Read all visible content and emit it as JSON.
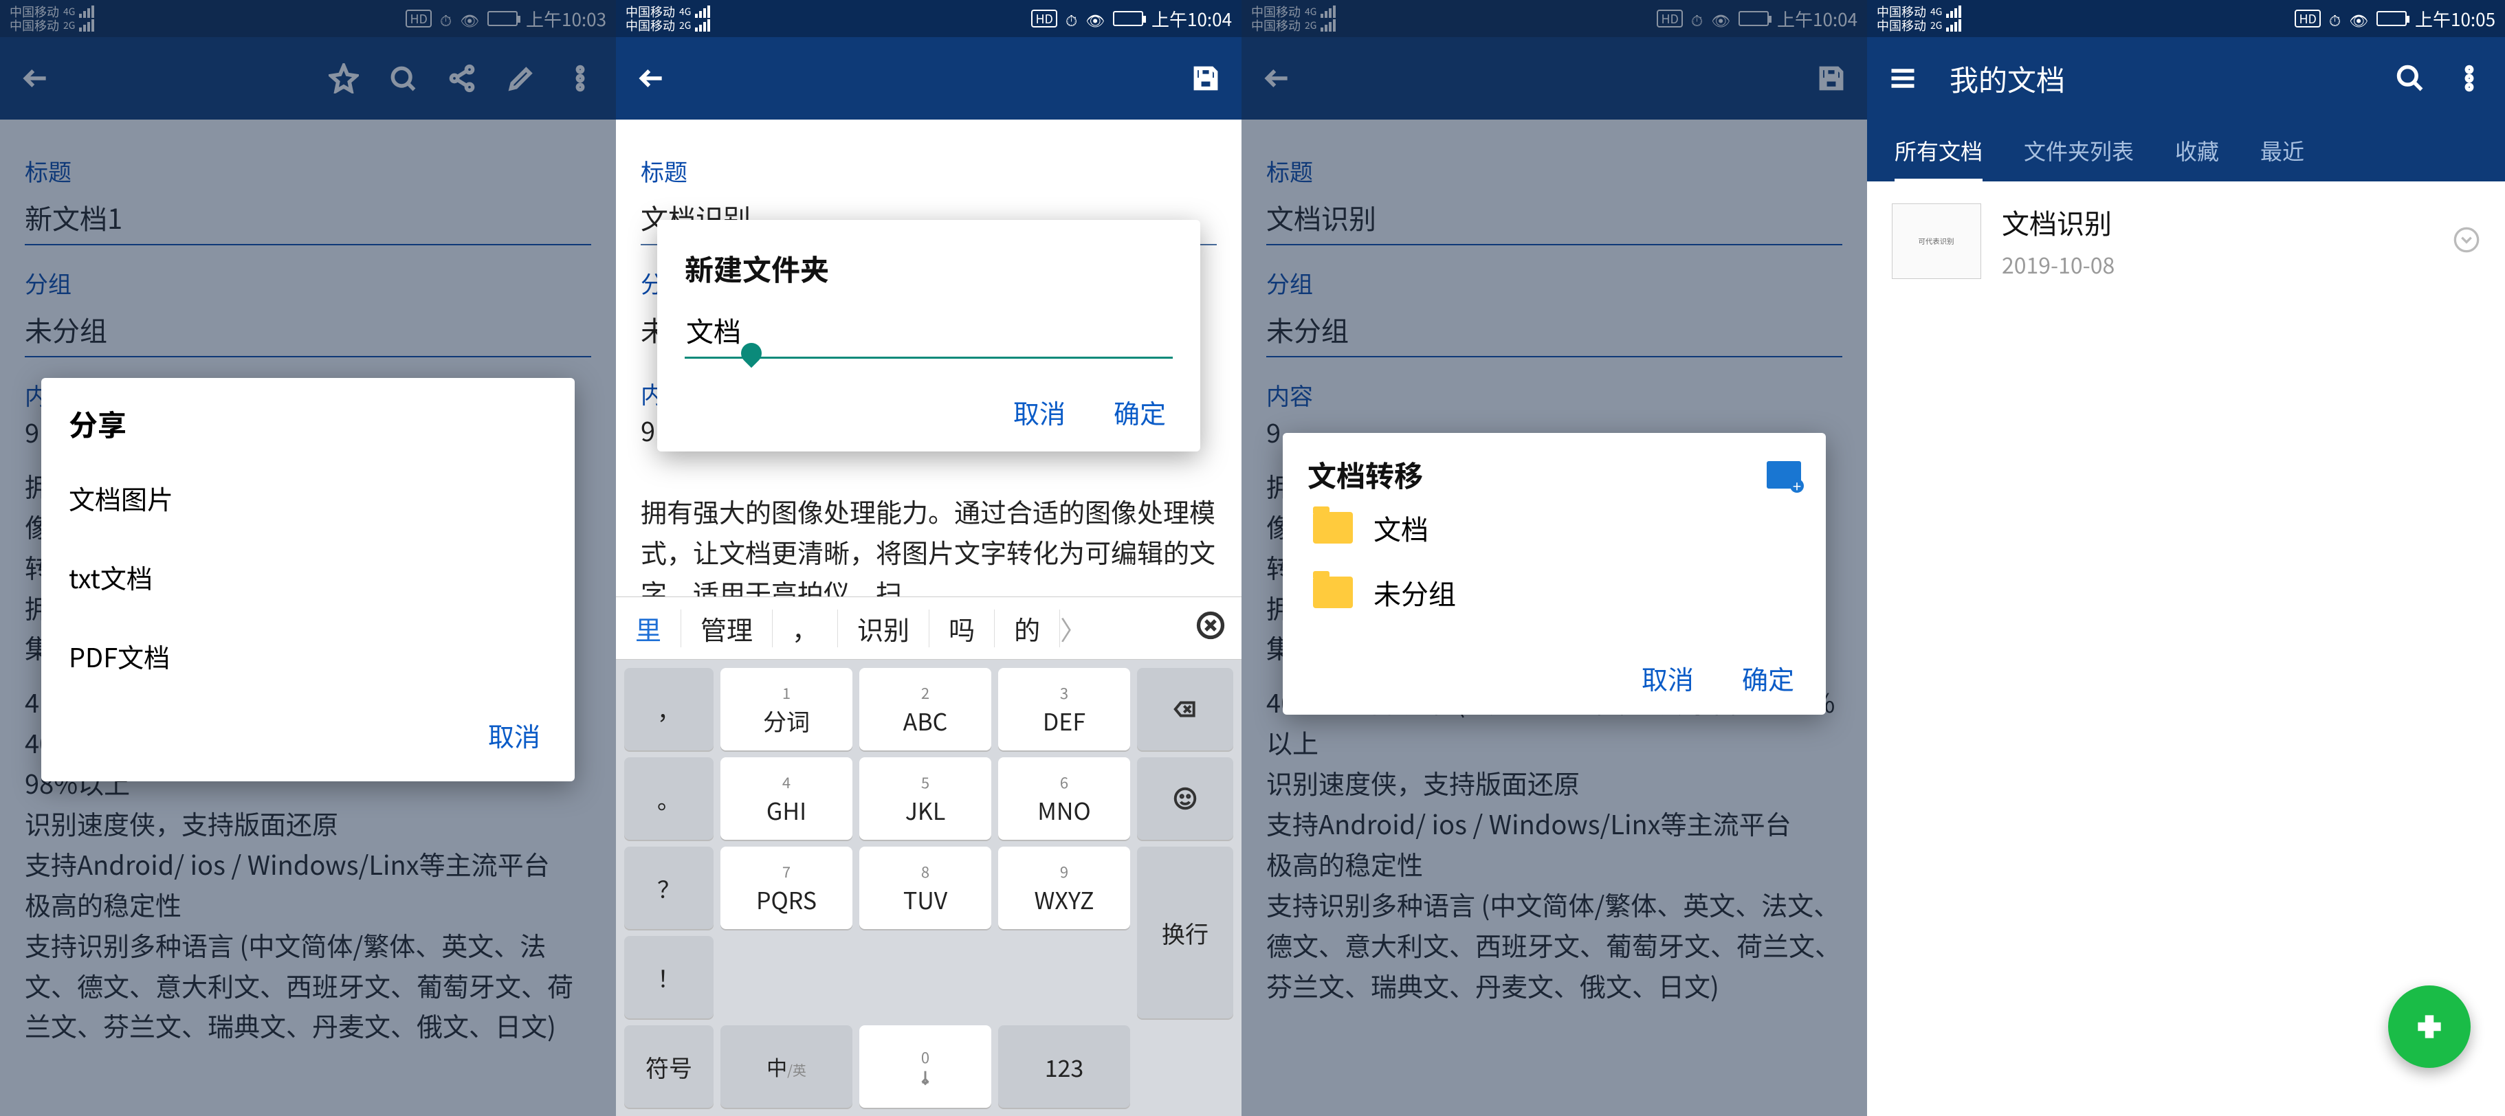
{
  "screens": [
    {
      "status": {
        "carrier": "中国移动",
        "net_tags": [
          "4G",
          "2G"
        ],
        "hd": "HD",
        "time": "上午10:03"
      },
      "form": {
        "title_label": "标题",
        "title_value": "新文档1",
        "group_label": "分组",
        "group_value": "未分组",
        "content_label": "内"
      },
      "body_prefix": "9",
      "body_suffix_lines": "400DPI扫描文档(AI办公纯文档） 识别率高达98%以上\n识别速度侠，支持版面还原\n支持Android/ ios / Windows/Linx等主流平台\n极高的稳定性\n支持识别多种语言 (中文简体/繁体、英文、法文、德文、意大利文、西班牙文、葡萄牙文、荷兰文、芬兰文、瑞典文、丹麦文、俄文、日文)",
      "body_mid_chars": [
        "拥",
        "像",
        "转",
        "拥",
        "集",
        "4"
      ],
      "share": {
        "title": "分享",
        "items": [
          "文档图片",
          "txt文档",
          "PDF文档"
        ],
        "cancel": "取消"
      }
    },
    {
      "status": {
        "carrier": "中国移动",
        "net_tags": [
          "4G",
          "2G"
        ],
        "hd": "HD",
        "time": "上午10:04"
      },
      "form": {
        "title_label": "标题",
        "title_value": "文档识别",
        "group_label": "分",
        "group_value": "未",
        "content_label": "内"
      },
      "body_full": "9.通用文档识别SDK\n\n拥有强大的图像处理能力。通过合适的图像处理模式，让文档更清晰，将图片文字转化为可编辑的文字，适用于高拍仪、扫",
      "dialog": {
        "title": "新建文件夹",
        "input_value": "文档",
        "cancel": "取消",
        "confirm": "确定"
      },
      "keyboard": {
        "suggestions": [
          "里",
          "管理",
          "，",
          "识别",
          "吗",
          "的"
        ],
        "keys_row1": [
          {
            "n": "1",
            "l": "分词"
          },
          {
            "n": "2",
            "l": "ABC"
          },
          {
            "n": "3",
            "l": "DEF"
          }
        ],
        "keys_row2": [
          {
            "n": "4",
            "l": "GHI"
          },
          {
            "n": "5",
            "l": "JKL"
          },
          {
            "n": "6",
            "l": "MNO"
          }
        ],
        "keys_row3": [
          {
            "n": "7",
            "l": "PQRS"
          },
          {
            "n": "8",
            "l": "TUV"
          },
          {
            "n": "9",
            "l": "WXYZ"
          }
        ],
        "left_col": [
          "，",
          "。",
          "？",
          "！"
        ],
        "right_col_enter": "换行",
        "bottom": {
          "symbol": "符号",
          "lang": "中/英",
          "num": "123"
        }
      }
    },
    {
      "status": {
        "carrier": "中国移动",
        "net_tags": [
          "4G",
          "2G"
        ],
        "hd": "HD",
        "time": "上午10:04"
      },
      "form": {
        "title_label": "标题",
        "title_value": "文档识别",
        "group_label": "分组",
        "group_value": "未分组",
        "content_label": "内容"
      },
      "body_prefix": "9",
      "body_mid_chars": [
        "拥",
        "像",
        "转",
        "拥",
        "集"
      ],
      "body_suffix_lines": "400DPI扫描文档(AI办公纯文档） 识别率高达98%以上\n识别速度侠，支持版面还原\n支持Android/ ios / Windows/Linx等主流平台\n极高的稳定性\n支持识别多种语言 (中文简体/繁体、英文、法文、德文、意大利文、西班牙文、葡萄牙文、荷兰文、芬兰文、瑞典文、丹麦文、俄文、日文)",
      "move": {
        "title": "文档转移",
        "folders": [
          "文档",
          "未分组"
        ],
        "cancel": "取消",
        "confirm": "确定"
      }
    },
    {
      "status": {
        "carrier": "中国移动",
        "net_tags": [
          "4G",
          "2G"
        ],
        "hd": "HD",
        "time": "上午10:05"
      },
      "appbar_title": "我的文档",
      "tabs": [
        "所有文档",
        "文件夹列表",
        "收藏",
        "最近"
      ],
      "active_tab": 0,
      "docs": [
        {
          "name": "文档识别",
          "date": "2019-10-08",
          "thumb_text": "可代表识别"
        }
      ]
    }
  ],
  "chart_data": null
}
